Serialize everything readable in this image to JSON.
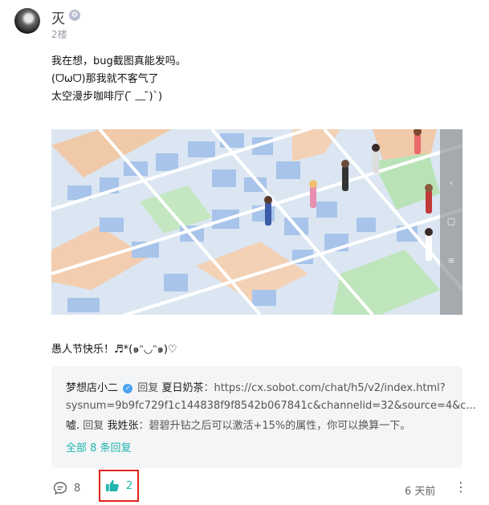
{
  "post": {
    "username": "灭",
    "badge_icon": "level-badge-icon",
    "floor": "2楼",
    "lines": [
      "我在想，bug截图真能发吗。",
      "(ᗜωᗜ)那我就不客气了",
      "太空漫步咖啡厅( ̄ ﹏ ̄)`)"
    ],
    "closing_line": "愚人节快乐！♬*(๑ᵔ◡ᵔ๑)♡"
  },
  "reply": {
    "user": "梦想店小二",
    "verify_icon": "verified-icon",
    "reply_word": "回复",
    "target": "夏日奶茶",
    "content": "：https://cx.sobot.com/chat/h5/v2/index.html?sysnum=9b9fc729f1c144838f9f8542b067841c&channelid=32&source=4&c...",
    "line2_user": "嘘.",
    "line2_reply_word": "回复",
    "line2_target": "我姓张",
    "line2_content": "：碧碧升钻之后可以激活+15%的属性，你可以换算一下。",
    "more_link": "全部 8 条回复"
  },
  "actions": {
    "comment_count": "8",
    "like_count": "2",
    "time": "6 天前"
  },
  "colors": {
    "accent": "#1fb5ad",
    "highlight_border": "#e2231a"
  }
}
